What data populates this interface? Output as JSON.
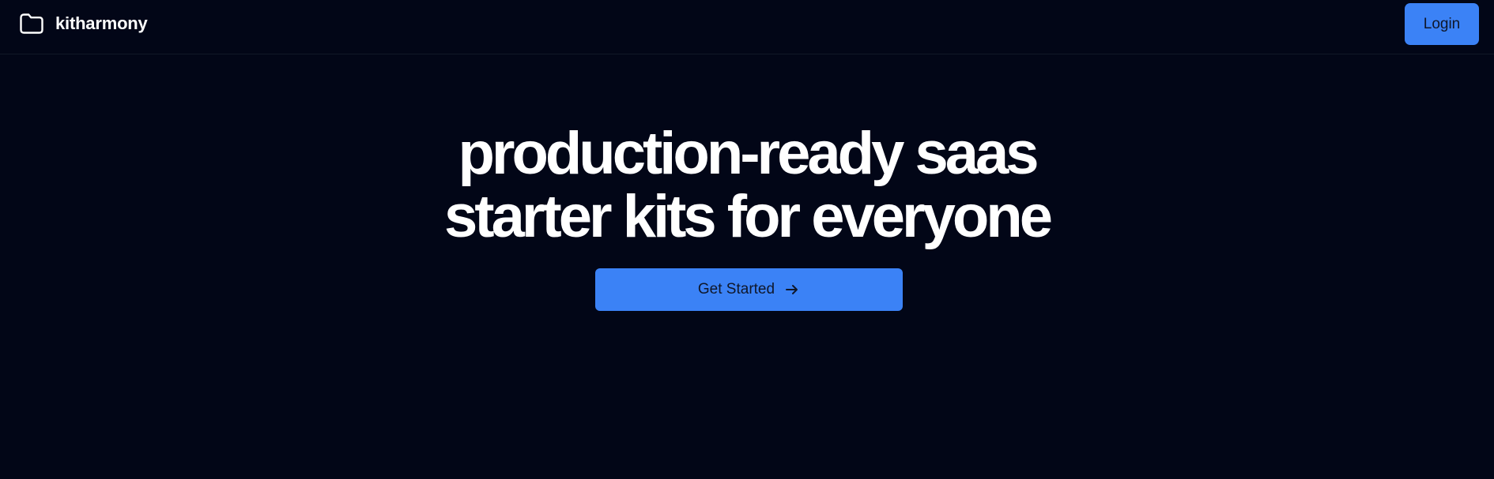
{
  "header": {
    "brand_name": "kitharmony",
    "brand_icon": "folder-icon",
    "login_label": "Login"
  },
  "hero": {
    "title_line_1": "production-ready saas",
    "title_line_2": "starter kits for everyone",
    "cta_label": "Get Started",
    "cta_icon": "arrow-right-icon"
  },
  "colors": {
    "background": "#020617",
    "text": "#ffffff",
    "accent": "#3b82f6",
    "button_text": "#0f172a"
  }
}
